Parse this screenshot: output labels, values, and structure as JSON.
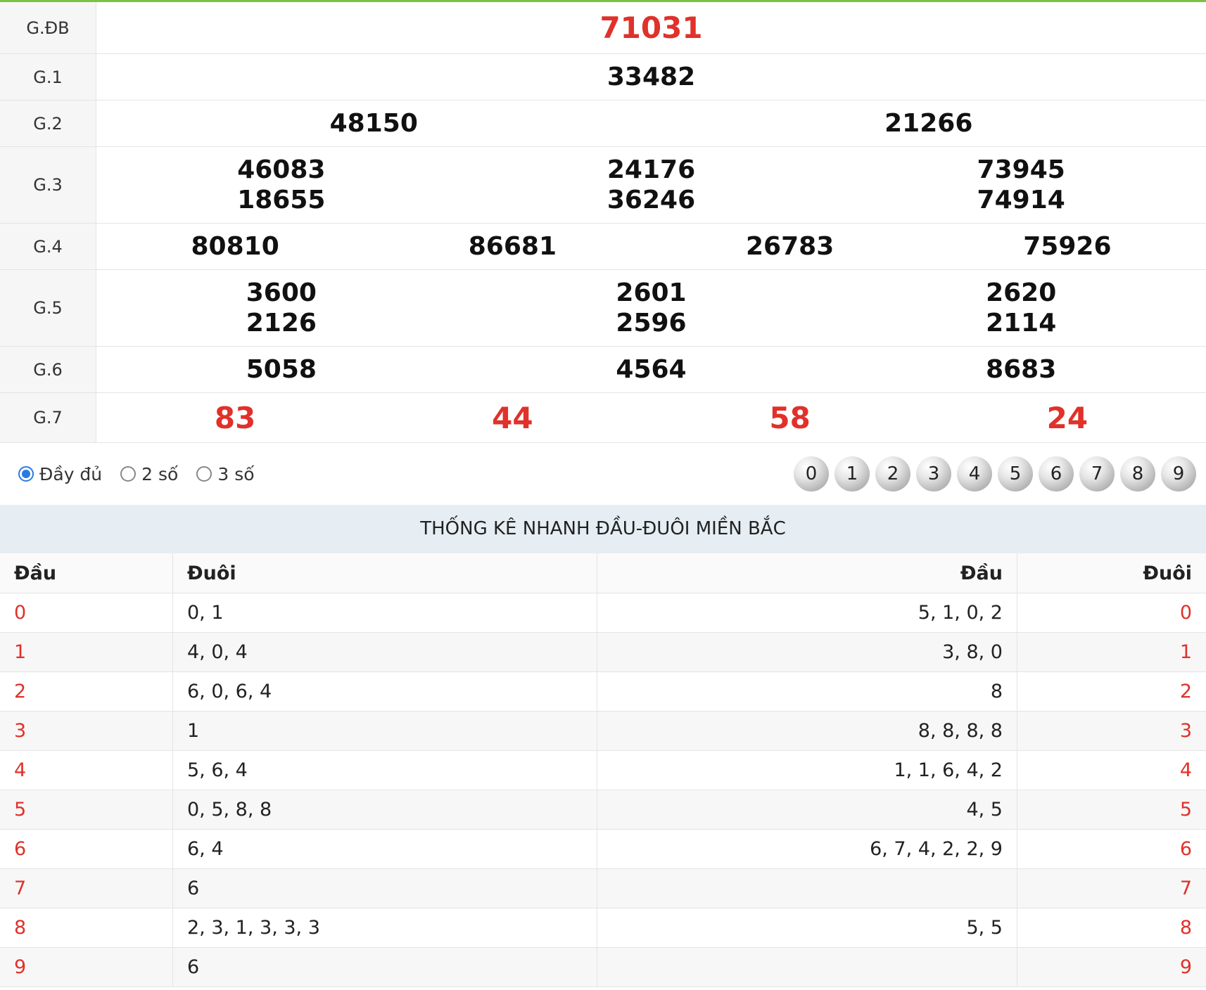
{
  "prizes": [
    {
      "label": "G.ĐB",
      "rows": [
        [
          "71031"
        ]
      ]
    },
    {
      "label": "G.1",
      "rows": [
        [
          "33482"
        ]
      ]
    },
    {
      "label": "G.2",
      "rows": [
        [
          "48150",
          "21266"
        ]
      ]
    },
    {
      "label": "G.3",
      "rows": [
        [
          "46083",
          "24176",
          "73945"
        ],
        [
          "18655",
          "36246",
          "74914"
        ]
      ]
    },
    {
      "label": "G.4",
      "rows": [
        [
          "80810",
          "86681",
          "26783",
          "75926"
        ]
      ]
    },
    {
      "label": "G.5",
      "rows": [
        [
          "3600",
          "2601",
          "2620"
        ],
        [
          "2126",
          "2596",
          "2114"
        ]
      ]
    },
    {
      "label": "G.6",
      "rows": [
        [
          "5058",
          "4564",
          "8683"
        ]
      ]
    },
    {
      "label": "G.7",
      "rows": [
        [
          "83",
          "44",
          "58",
          "24"
        ]
      ]
    }
  ],
  "filters": {
    "options": [
      "Đầy đủ",
      "2 số",
      "3 số"
    ],
    "selected": "Đầy đủ"
  },
  "digit_balls": [
    "0",
    "1",
    "2",
    "3",
    "4",
    "5",
    "6",
    "7",
    "8",
    "9"
  ],
  "stats": {
    "title": "THỐNG KÊ NHANH ĐẦU-ĐUÔI MIỀN BẮC",
    "headers": [
      "Đầu",
      "Đuôi",
      "Đầu",
      "Đuôi"
    ],
    "rows": [
      {
        "dau": "0",
        "duoi": "0, 1",
        "dau2": "5, 1, 0, 2",
        "duoi2": "0"
      },
      {
        "dau": "1",
        "duoi": "4, 0, 4",
        "dau2": "3, 8, 0",
        "duoi2": "1"
      },
      {
        "dau": "2",
        "duoi": "6, 0, 6, 4",
        "dau2": "8",
        "duoi2": "2"
      },
      {
        "dau": "3",
        "duoi": "1",
        "dau2": "8, 8, 8, 8",
        "duoi2": "3"
      },
      {
        "dau": "4",
        "duoi": "5, 6, 4",
        "dau2": "1, 1, 6, 4, 2",
        "duoi2": "4"
      },
      {
        "dau": "5",
        "duoi": "0, 5, 8, 8",
        "dau2": "4, 5",
        "duoi2": "5"
      },
      {
        "dau": "6",
        "duoi": "6, 4",
        "dau2": "6, 7, 4, 2, 2, 9",
        "duoi2": "6"
      },
      {
        "dau": "7",
        "duoi": "6",
        "dau2": "",
        "duoi2": "7"
      },
      {
        "dau": "8",
        "duoi": "2, 3, 1, 3, 3, 3",
        "dau2": "5, 5",
        "duoi2": "8"
      },
      {
        "dau": "9",
        "duoi": "6",
        "dau2": "",
        "duoi2": "9"
      }
    ]
  },
  "colors": {
    "accent_red": "#e0312a",
    "top_bar": "#7cc242",
    "radio_blue": "#2a7ae2"
  }
}
